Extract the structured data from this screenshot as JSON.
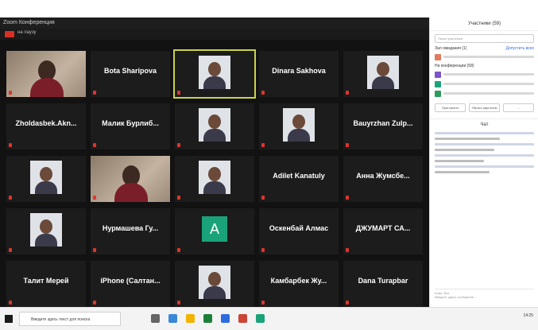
{
  "window": {
    "title": "Zoom Конференция"
  },
  "recording": {
    "badge": "REC",
    "text": "на паузу"
  },
  "participants": [
    {
      "name": "",
      "label": "",
      "type": "video"
    },
    {
      "name": "Bota Sharipova",
      "label": "",
      "type": "name"
    },
    {
      "name": "",
      "label": "",
      "type": "photo",
      "active": true
    },
    {
      "name": "Dinara Sakhova",
      "label": "",
      "type": "name"
    },
    {
      "name": "",
      "label": "",
      "type": "photo"
    },
    {
      "name": "Zholdasbek.Akn...",
      "label": "",
      "type": "name"
    },
    {
      "name": "Малик Бурлиб...",
      "label": "",
      "type": "name"
    },
    {
      "name": "",
      "label": "",
      "type": "photo"
    },
    {
      "name": "",
      "label": "",
      "type": "photo"
    },
    {
      "name": "Bauyrzhan Zulp...",
      "label": "",
      "type": "name"
    },
    {
      "name": "",
      "label": "",
      "type": "photo"
    },
    {
      "name": "",
      "label": "",
      "type": "video"
    },
    {
      "name": "",
      "label": "",
      "type": "photo"
    },
    {
      "name": "Adilet Kanatuly",
      "label": "",
      "type": "name"
    },
    {
      "name": "Анна Жумсбе...",
      "label": "",
      "type": "name"
    },
    {
      "name": "",
      "label": "",
      "type": "photo"
    },
    {
      "name": "Нурмашева Гу...",
      "label": "",
      "type": "name"
    },
    {
      "name": "A",
      "label": "",
      "type": "avatar"
    },
    {
      "name": "Оскенбай Алмас",
      "label": "",
      "type": "name"
    },
    {
      "name": "ДЖУМАРТ СА...",
      "label": "",
      "type": "name"
    },
    {
      "name": "Талит Мерей",
      "label": "",
      "type": "name"
    },
    {
      "name": "iPhone (Салтан...",
      "label": "",
      "type": "name"
    },
    {
      "name": "",
      "label": "",
      "type": "photo"
    },
    {
      "name": "Камбарбек Жу...",
      "label": "",
      "type": "name"
    },
    {
      "name": "Dana Turapbar",
      "label": "",
      "type": "name"
    }
  ],
  "sidebar": {
    "header": "Участники (59)",
    "search_placeholder": "Поиск участника",
    "waiting_title": "Зал ожидания (1)",
    "admit_all": "Допустить всех",
    "conference_title": "На конференции (58)",
    "buttons": [
      "Пригласить",
      "Убрать звук всем",
      "..."
    ],
    "chat_title": "Чат",
    "chat_to": "Кому: Все",
    "chat_placeholder": "Введите здесь сообщение..."
  },
  "taskbar": {
    "search_text": "Введите здесь текст для поиска",
    "time": "14:25"
  },
  "colors": {
    "tile_bg": "#1c1c1c",
    "active_border": "#c9d24a",
    "mic_muted": "#e0352b",
    "avatar": "#1aa37a"
  }
}
